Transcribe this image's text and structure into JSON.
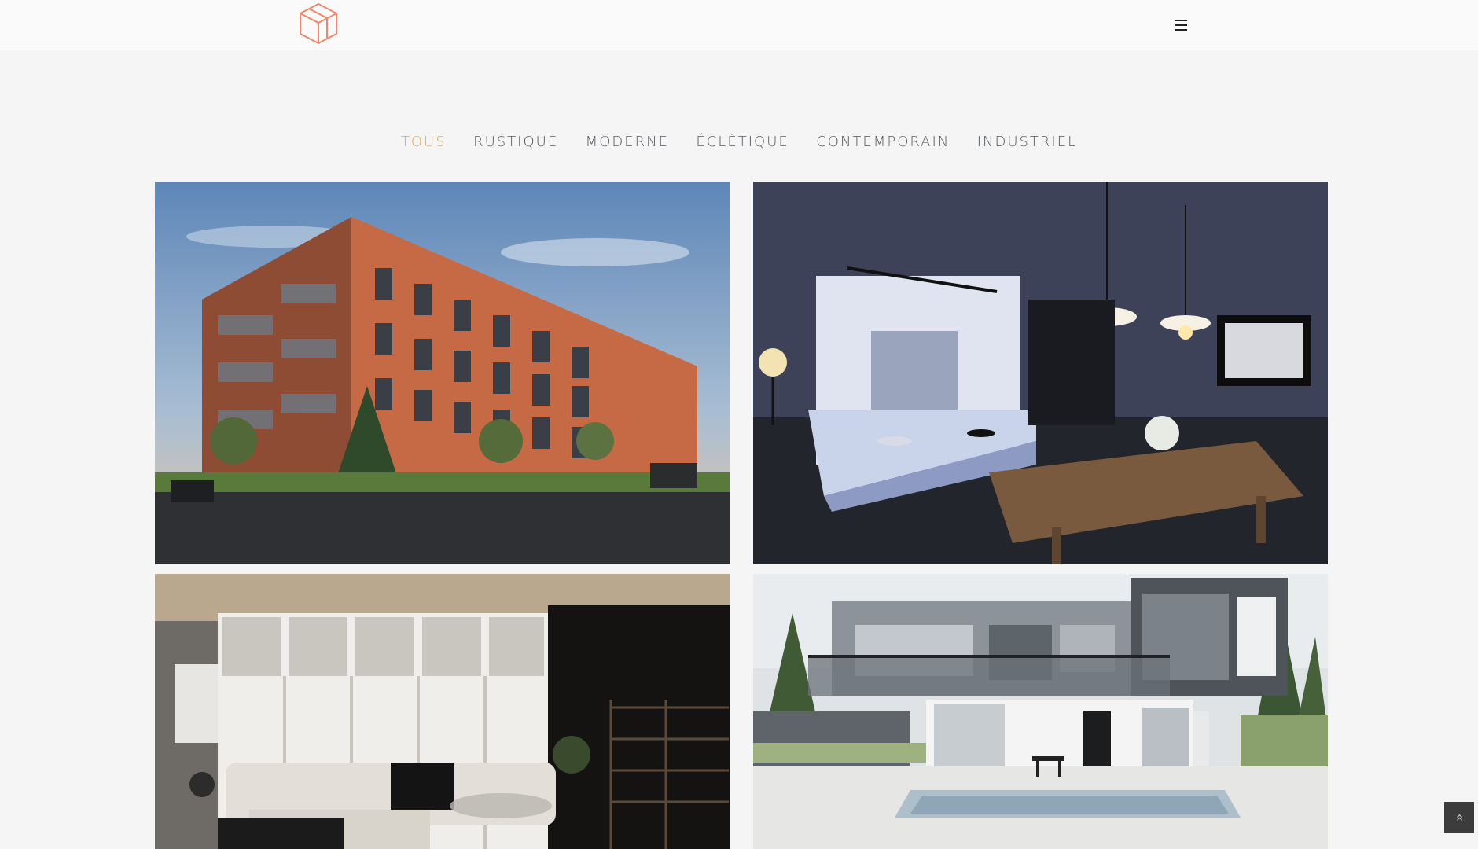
{
  "header": {
    "logo_icon": "cube-logo-icon",
    "menu_icon": "hamburger-menu-icon"
  },
  "filters": [
    {
      "label": "TOUS",
      "active": true
    },
    {
      "label": "RUSTIQUE",
      "active": false
    },
    {
      "label": "MODERNE",
      "active": false
    },
    {
      "label": "ÉCLÉTIQUE",
      "active": false
    },
    {
      "label": "CONTEMPORAIN",
      "active": false
    },
    {
      "label": "INDUSTRIEL",
      "active": false
    }
  ],
  "gallery": [
    {
      "name": "apartment-building-render"
    },
    {
      "name": "kitchen-dining-render"
    },
    {
      "name": "living-room-render"
    },
    {
      "name": "modern-house-pool-render"
    }
  ],
  "scroll_top": {
    "icon": "double-chevron-up-icon",
    "glyph": "«"
  },
  "colors": {
    "accent": "#e8a93c",
    "logo": "#f0866a",
    "filter_text": "#555a60",
    "background": "#f5f5f5"
  }
}
